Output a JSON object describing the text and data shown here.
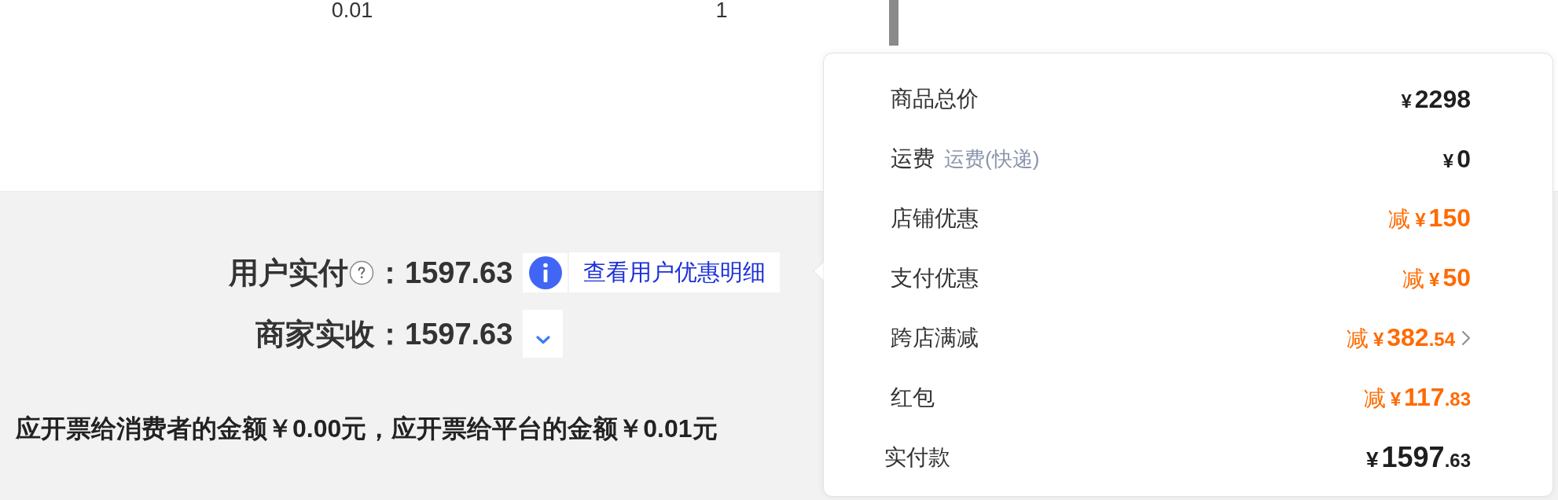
{
  "table": {
    "rows": [
      {
        "cells": [
          "0.01",
          "1"
        ]
      }
    ]
  },
  "payment_summary": {
    "rows": [
      {
        "label": "用户实付",
        "help": true,
        "value": "：1597.63",
        "action": {
          "kind": "link",
          "text": "查看用户优惠明细"
        }
      },
      {
        "label": "商家实收",
        "help": false,
        "value": "：1597.63",
        "action": {
          "kind": "toggle",
          "expanded": false
        }
      }
    ]
  },
  "invoice_note": "应开票给消费者的金额￥0.00元，应开票给平台的金额￥0.01元",
  "price_popover": {
    "rows": [
      {
        "kind": "charge",
        "label": "商品总价",
        "currency": "¥",
        "whole": "2298",
        "drilldown": false
      },
      {
        "kind": "charge",
        "label": "运费",
        "note": "运费(快递)",
        "currency": "¥",
        "whole": "0",
        "drilldown": false
      },
      {
        "kind": "discount",
        "label": "店铺优惠",
        "sign": "减",
        "currency": "¥",
        "whole": "150",
        "drilldown": false
      },
      {
        "kind": "discount",
        "label": "支付优惠",
        "sign": "减",
        "currency": "¥",
        "whole": "50",
        "drilldown": false
      },
      {
        "kind": "discount",
        "label": "跨店满减",
        "sign": "减",
        "currency": "¥",
        "whole": "382",
        "fraction": ".54",
        "drilldown": true
      },
      {
        "kind": "discount",
        "label": "红包",
        "sign": "减",
        "currency": "¥",
        "whole": "117",
        "fraction": ".83",
        "drilldown": false
      },
      {
        "kind": "total",
        "label": "实付款",
        "currency": "¥",
        "whole": "1597",
        "fraction": ".63",
        "drilldown": false
      }
    ]
  }
}
